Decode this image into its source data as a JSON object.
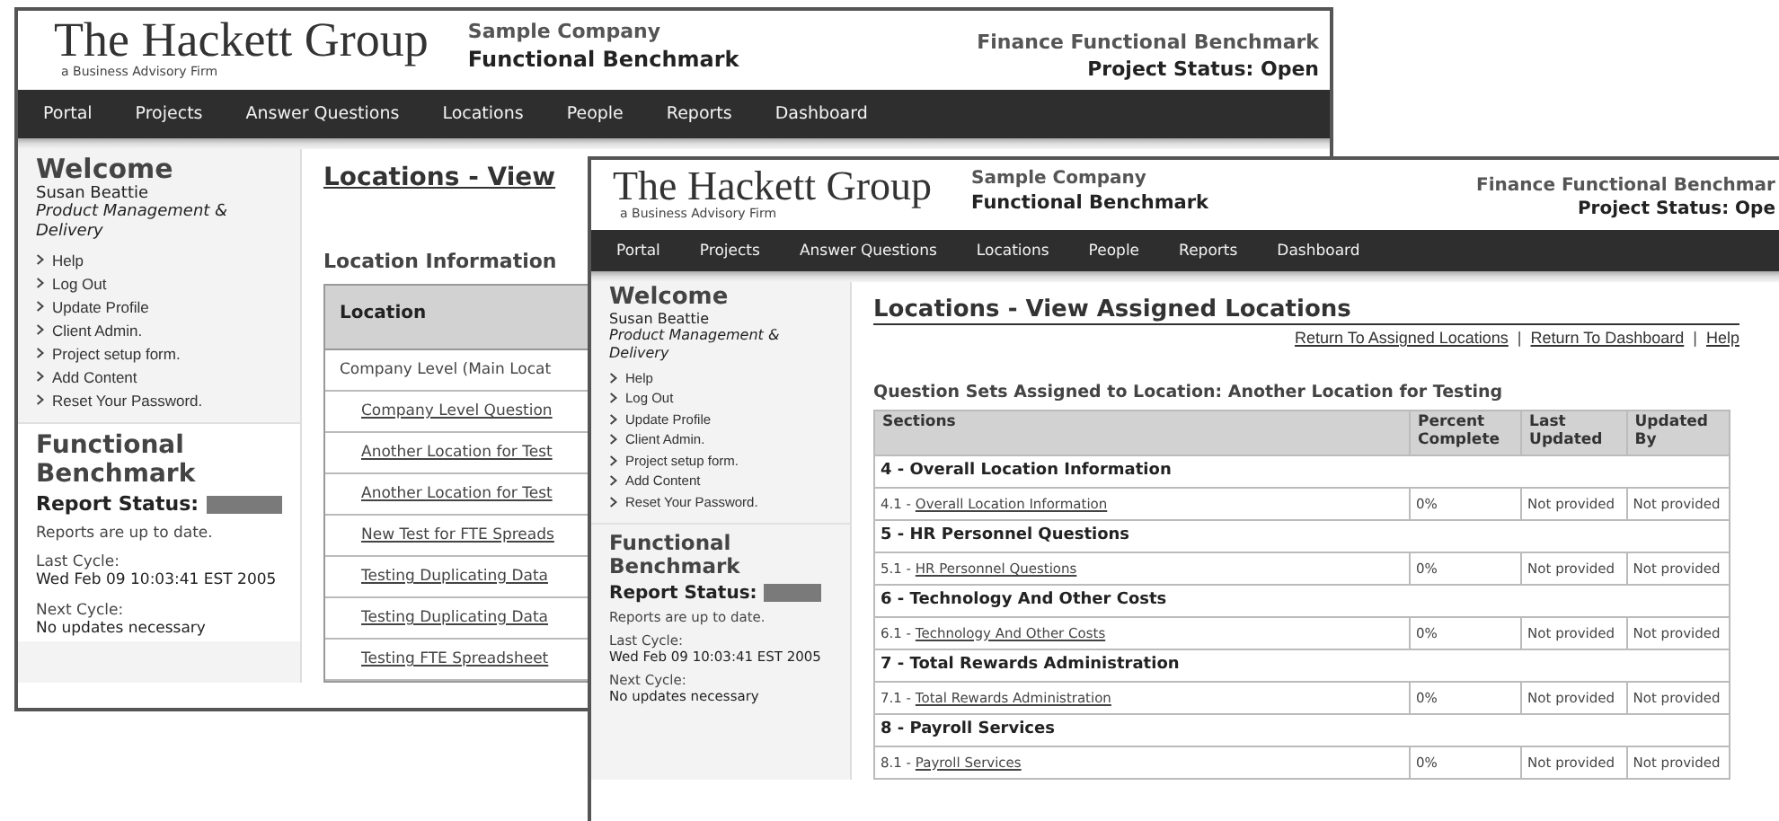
{
  "windows": [
    {
      "header": {
        "logo": "The Hackett Group",
        "tagline": "a Business Advisory Firm",
        "company": "Sample Company",
        "product": "Functional Benchmark",
        "title": "Finance Functional Benchmark",
        "status": "Project Status: Open"
      },
      "nav": [
        "Portal",
        "Projects",
        "Answer Questions",
        "Locations",
        "People",
        "Reports",
        "Dashboard"
      ],
      "sidebar": {
        "welcome": "Welcome",
        "user": "Susan Beattie",
        "role": "Product Management & Delivery",
        "links": [
          "Help",
          "Log Out",
          "Update Profile",
          "Client Admin.",
          "Project setup form.",
          "Add Content",
          "Reset Your Password."
        ],
        "section_title": "Functional Benchmark",
        "report_status": "Report Status:",
        "note": "Reports are up to date.",
        "last_cycle_label": "Last Cycle:",
        "last_cycle": "Wed Feb 09 10:03:41 EST 2005",
        "next_cycle_label": "Next Cycle:",
        "next_cycle": "No updates necessary"
      },
      "content": {
        "kind": "location_list",
        "title": "Locations - View",
        "subtitle": "Location Information",
        "column": "Location",
        "rows": [
          {
            "text": "Company Level (Main Locat",
            "link": false
          },
          {
            "text": "Company Level Question",
            "link": true
          },
          {
            "text": "Another Location for Test",
            "link": true
          },
          {
            "text": "Another Location for Test",
            "link": true
          },
          {
            "text": "New Test for FTE Spreads",
            "link": true
          },
          {
            "text": "Testing Duplicating Data",
            "link": true
          },
          {
            "text": "Testing Duplicating Data",
            "link": true
          },
          {
            "text": "Testing FTE Spreadsheet",
            "link": true
          }
        ]
      }
    },
    {
      "header": {
        "logo": "The Hackett Group",
        "tagline": "a Business Advisory Firm",
        "company": "Sample Company",
        "product": "Functional Benchmark",
        "title": "Finance Functional Benchmar",
        "status": "Project Status: Ope"
      },
      "nav": [
        "Portal",
        "Projects",
        "Answer Questions",
        "Locations",
        "People",
        "Reports",
        "Dashboard"
      ],
      "sidebar": {
        "welcome": "Welcome",
        "user": "Susan Beattie",
        "role": "Product Management & Delivery",
        "links": [
          "Help",
          "Log Out",
          "Update Profile",
          "Client Admin.",
          "Project setup form.",
          "Add Content",
          "Reset Your Password."
        ],
        "section_title": "Functional Benchmark",
        "report_status": "Report Status:",
        "note": "Reports are up to date.",
        "last_cycle_label": "Last Cycle:",
        "last_cycle": "Wed Feb 09 10:03:41 EST 2005",
        "next_cycle_label": "Next Cycle:",
        "next_cycle": "No updates necessary"
      },
      "content": {
        "kind": "question_sets",
        "title": "Locations - View Assigned Locations",
        "links": [
          "Return To Assigned Locations",
          "Return To Dashboard",
          "Help"
        ],
        "separator": "|",
        "subtitle": "Question Sets Assigned to Location: Another Location for Testing",
        "columns": [
          "Sections",
          "Percent Complete",
          "Last Updated",
          "Updated By"
        ],
        "groups": [
          {
            "title": "4 - Overall Location Information",
            "items": [
              {
                "number": "4.1 -",
                "name": "Overall Location Information",
                "percent": "0%",
                "last_updated": "Not provided",
                "updated_by": "Not provided"
              }
            ]
          },
          {
            "title": "5 - HR Personnel Questions",
            "items": [
              {
                "number": "5.1 -",
                "name": "HR Personnel Questions",
                "percent": "0%",
                "last_updated": "Not provided",
                "updated_by": "Not provided"
              }
            ]
          },
          {
            "title": "6 - Technology And Other Costs",
            "items": [
              {
                "number": "6.1 -",
                "name": "Technology And Other Costs",
                "percent": "0%",
                "last_updated": "Not provided",
                "updated_by": "Not provided"
              }
            ]
          },
          {
            "title": "7 - Total Rewards Administration",
            "items": [
              {
                "number": "7.1 -",
                "name": "Total Rewards Administration",
                "percent": "0%",
                "last_updated": "Not provided",
                "updated_by": "Not provided"
              }
            ]
          },
          {
            "title": "8 - Payroll Services",
            "items": [
              {
                "number": "8.1 -",
                "name": "Payroll Services",
                "percent": "0%",
                "last_updated": "Not provided",
                "updated_by": "Not provided"
              }
            ]
          }
        ]
      }
    }
  ]
}
